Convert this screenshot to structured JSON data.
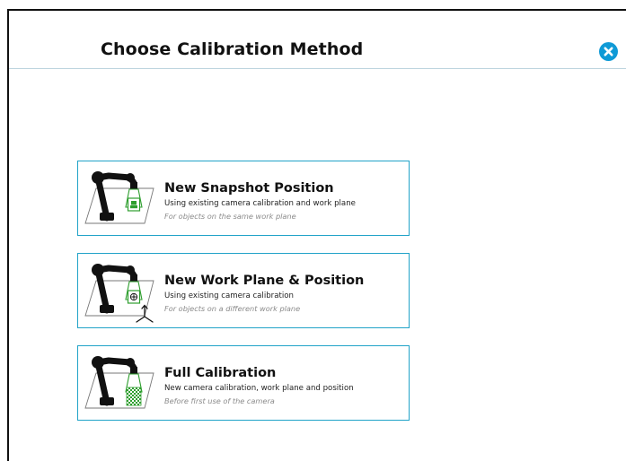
{
  "dialog": {
    "title": "Choose Calibration Method",
    "close_icon": "close-icon",
    "accent_color": "#0f9ad6",
    "border_color": "#21a3c8"
  },
  "options": [
    {
      "title": "New Snapshot Position",
      "description": "Using existing camera calibration and work plane",
      "note": "For objects on the same work plane",
      "icon": "robot-arm-snapshot-icon"
    },
    {
      "title": "New Work Plane & Position",
      "description": "Using existing camera calibration",
      "note": "For objects on a different work plane",
      "icon": "robot-arm-work-plane-icon"
    },
    {
      "title": "Full Calibration",
      "description": "New camera calibration, work plane and position",
      "note": "Before first use of the camera",
      "icon": "robot-arm-calibration-grid-icon"
    }
  ]
}
